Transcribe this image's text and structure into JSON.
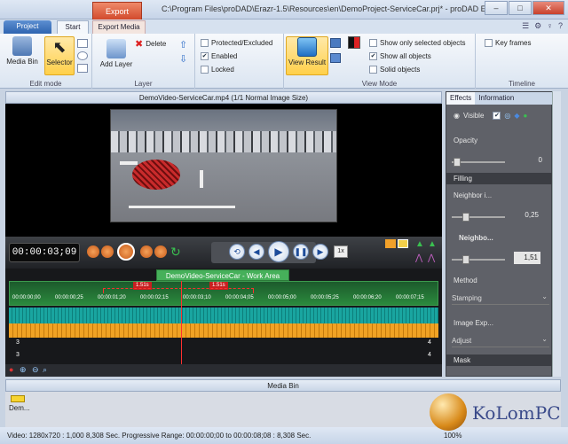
{
  "window": {
    "context_tab": "Export",
    "title": "C:\\Program Files\\proDAD\\Erazr-1.5\\Resources\\en\\DemoProject-ServiceCar.prj* - proDAD Erazr",
    "min_label": "–",
    "max_label": "□",
    "close_label": "✕"
  },
  "tabs": {
    "project": "Project",
    "start": "Start",
    "export_media": "Export Media"
  },
  "ribbon": {
    "media_bin": "Media Bin",
    "selector": "Selector",
    "delete": "Delete",
    "add_layer": "Add Layer",
    "edit_mode": "Edit mode",
    "layer": "Layer",
    "protected": "Protected/Excluded",
    "enabled": "Enabled",
    "locked": "Locked",
    "view_result": "View Result",
    "show_selected": "Show only selected objects",
    "show_all": "Show all objects",
    "solid": "Solid objects",
    "view_mode": "View Mode",
    "key_frames": "Key frames",
    "timeline": "Timeline",
    "check_mark": "✔"
  },
  "viewer": {
    "header": "DemoVideo-ServiceCar.mp4   (1/1  Normal Image Size)"
  },
  "transport": {
    "timecode": "00:00:03;09",
    "speed": "1x"
  },
  "timeline": {
    "work_area": "DemoVideo-ServiceCar - Work Area",
    "badges": [
      "1.51s",
      "1.51s"
    ],
    "ticks": [
      "00:00:00;00",
      "00:00:00;25",
      "00:00:01;20",
      "00:00:02;15",
      "00:00:03;10",
      "00:00:04;05",
      "00:00:05;00",
      "00:00:05;25",
      "00:00:06;20",
      "00:00:07;15"
    ],
    "track_nums": [
      "3",
      "4",
      "3",
      "4"
    ]
  },
  "effects": {
    "tab_effects": "Effects",
    "tab_info": "Information",
    "visible": "Visible",
    "opacity": "Opacity",
    "opacity_value": "0",
    "filling": "Filling",
    "neighbor1": "Neighbor i...",
    "neighbor1_value": "0,25",
    "neighbor2": "Neighbo...",
    "neighbor2_value": "1,51",
    "method": "Method",
    "stamping": "Stamping",
    "image_exp": "Image Exp...",
    "adjust": "Adjust",
    "mask": "Mask"
  },
  "media_bin": {
    "header": "Media Bin",
    "item": "Dem..."
  },
  "status": {
    "text": "Video: 1280x720 : 1,000   8,308 Sec.   Progressive  Range: 00:00:00;00 to 00:00:08;08 : 8,308 Sec.",
    "zoom": "100%"
  },
  "watermark": {
    "text": "KoLomPC"
  },
  "colors": {
    "accent": "#2e64b0",
    "export_tab": "#d24a2c",
    "timeline_teal": "#19a5a0",
    "timeline_orange": "#f0a224",
    "playhead": "#ff3030"
  }
}
